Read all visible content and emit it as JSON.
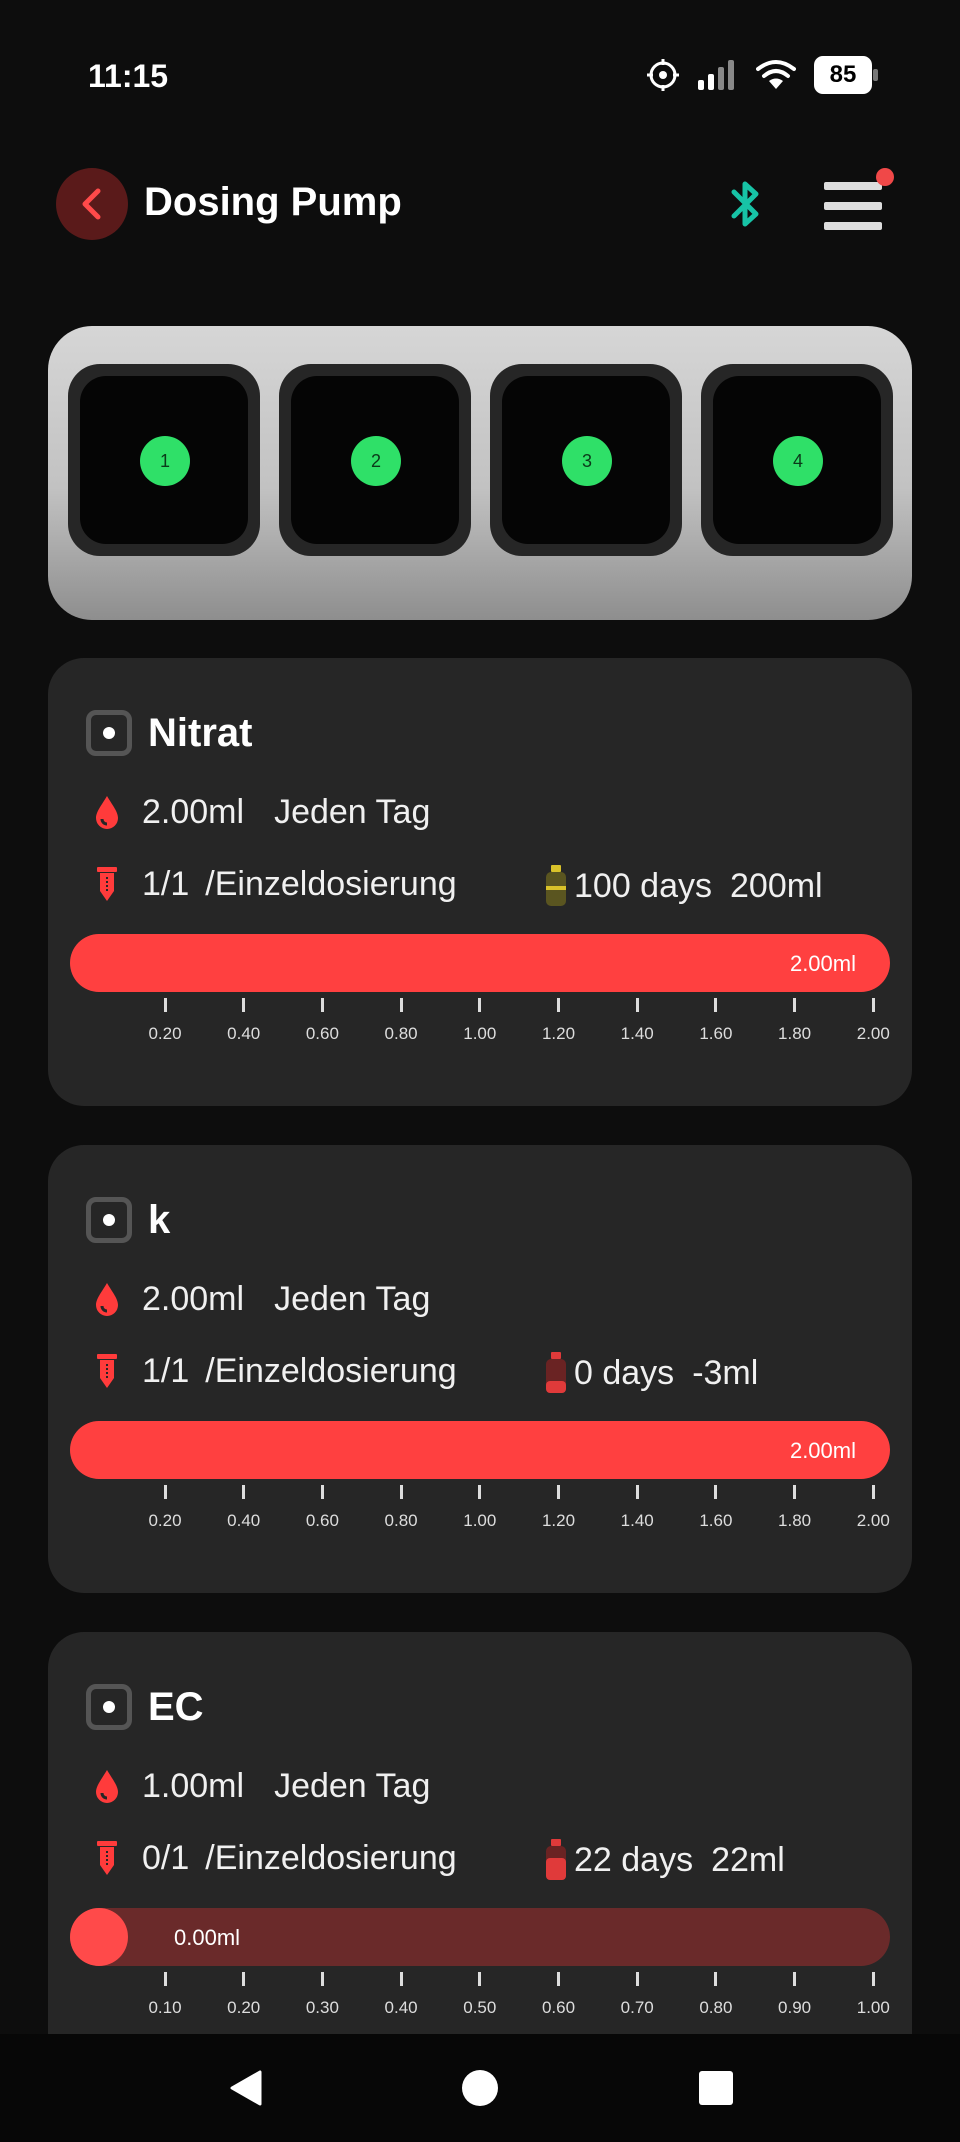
{
  "status_bar": {
    "time": "11:15",
    "battery": "85",
    "icons": [
      "location-target-icon",
      "signal-icon",
      "wifi-icon",
      "battery-icon"
    ]
  },
  "header": {
    "title": "Dosing Pump",
    "icons": [
      "back-arrow-icon",
      "bluetooth-icon",
      "menu-icon"
    ],
    "colors": {
      "accent": "#ff4040",
      "bluetooth": "#17c3a6",
      "notification": "#f04848"
    }
  },
  "pump": {
    "slots": [
      "1",
      "2",
      "3",
      "4"
    ],
    "slot_color": "#2fe068"
  },
  "channels": [
    {
      "name": "Nitrat",
      "dose": "2.00ml",
      "schedule": "Jeden Tag",
      "count": "1/1",
      "mode": "/Einzeldosierung",
      "days": "100 days",
      "volume": "200ml",
      "bottle_color": "#d9c22a",
      "progress_label": "2.00ml",
      "progress_fraction": 1.0,
      "ticks": [
        "0.20",
        "0.40",
        "0.60",
        "0.80",
        "1.00",
        "1.20",
        "1.40",
        "1.60",
        "1.80",
        "2.00"
      ]
    },
    {
      "name": "k",
      "dose": "2.00ml",
      "schedule": "Jeden Tag",
      "count": "1/1",
      "mode": "/Einzeldosierung",
      "days": "0 days",
      "volume": "-3ml",
      "bottle_color": "#e03a3a",
      "progress_label": "2.00ml",
      "progress_fraction": 1.0,
      "ticks": [
        "0.20",
        "0.40",
        "0.60",
        "0.80",
        "1.00",
        "1.20",
        "1.40",
        "1.60",
        "1.80",
        "2.00"
      ]
    },
    {
      "name": "EC",
      "dose": "1.00ml",
      "schedule": "Jeden Tag",
      "count": "0/1",
      "mode": "/Einzeldosierung",
      "days": "22 days",
      "volume": "22ml",
      "bottle_color": "#e03a3a",
      "progress_label": "0.00ml",
      "progress_fraction": 0.0,
      "ticks": [
        "0.10",
        "0.20",
        "0.30",
        "0.40",
        "0.50",
        "0.60",
        "0.70",
        "0.80",
        "0.90",
        "1.00"
      ]
    }
  ],
  "nav": {
    "icons": [
      "back-triangle-icon",
      "home-circle-icon",
      "recents-square-icon"
    ]
  }
}
